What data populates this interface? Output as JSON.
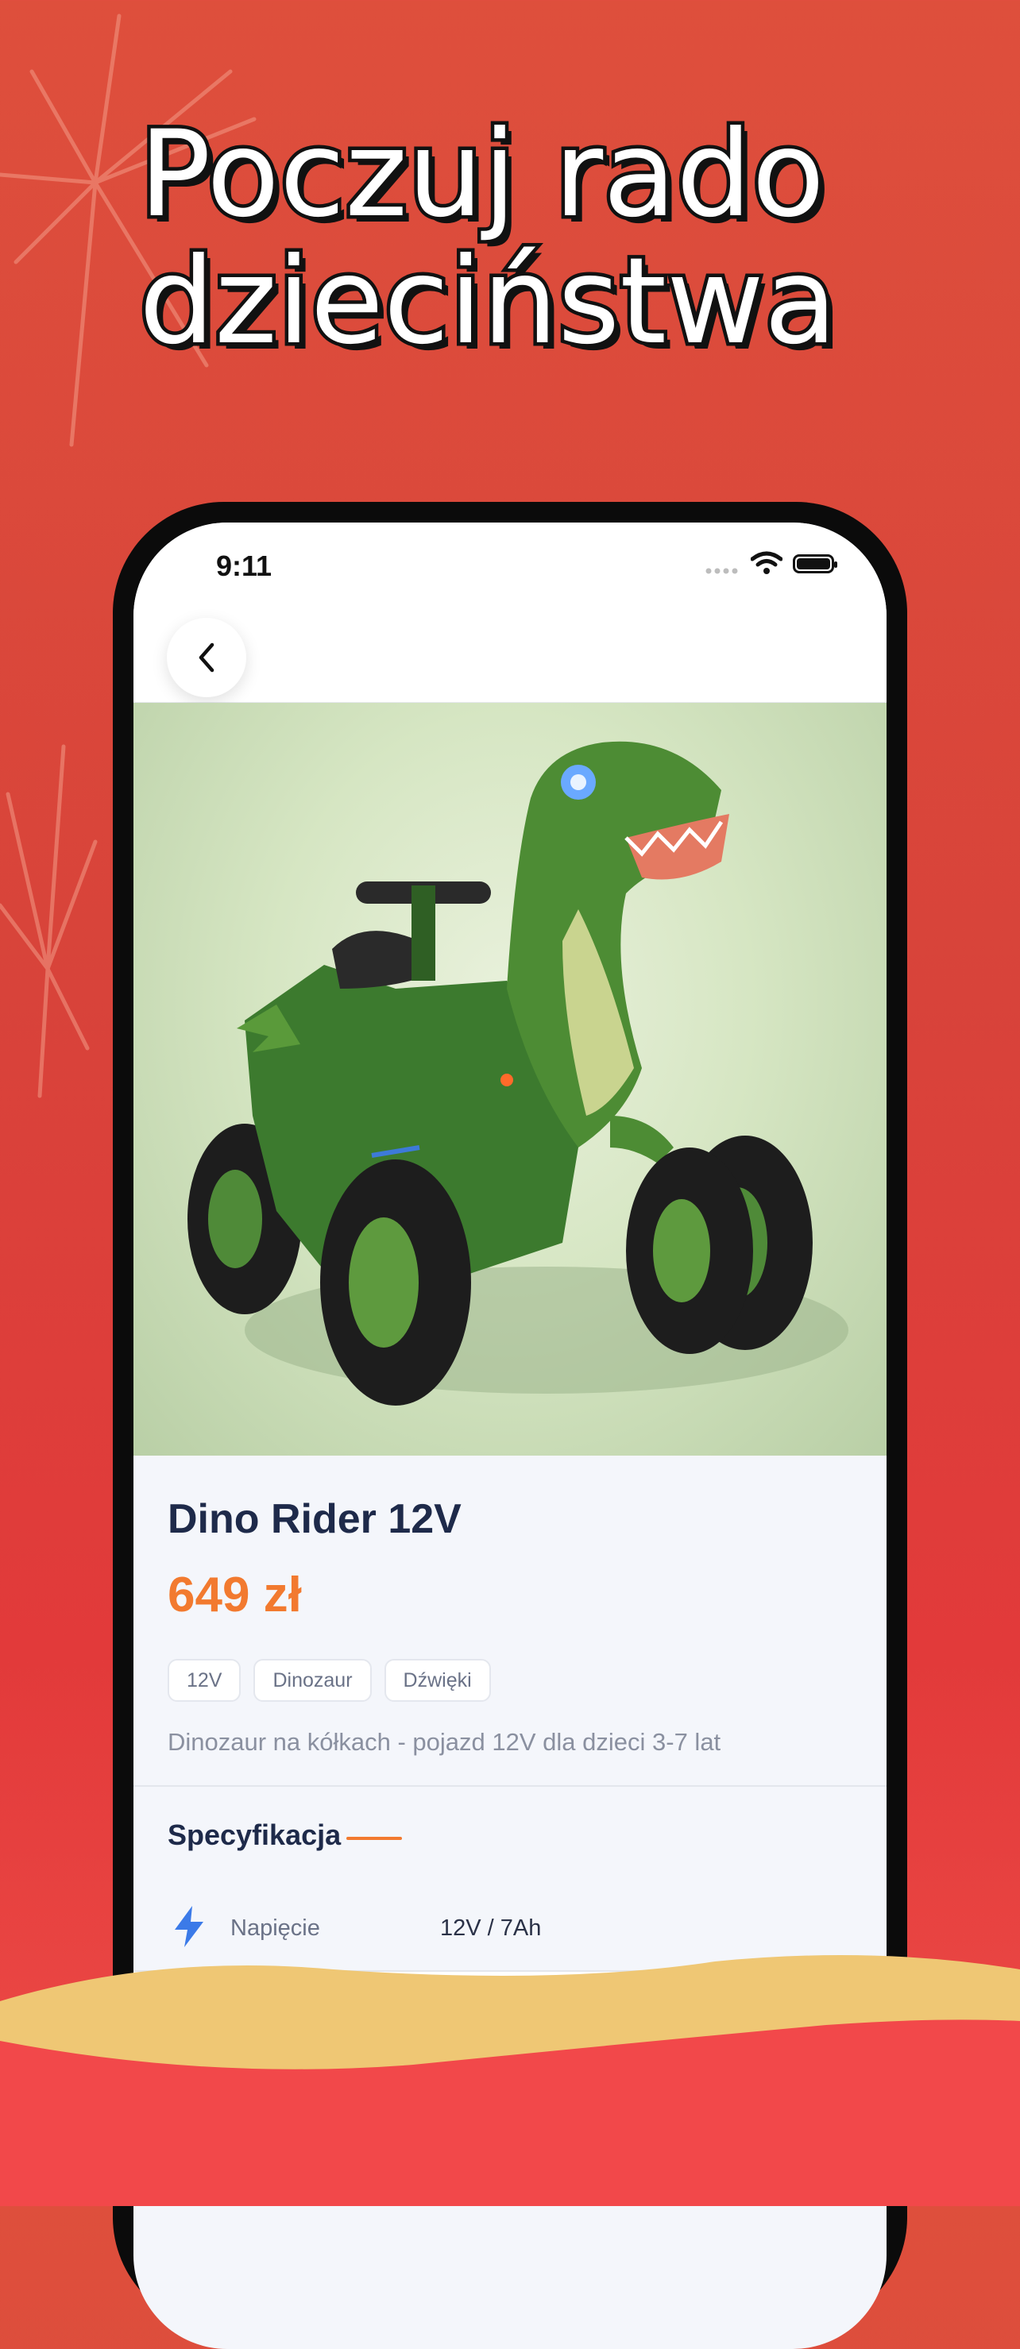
{
  "headline": {
    "line1": "Poczuj rado",
    "line2": "dzieciństwa"
  },
  "status_bar": {
    "time": "9:11"
  },
  "product": {
    "title": "Dino Rider 12V",
    "price": "649 zł",
    "tags": [
      "12V",
      "Dinozaur",
      "Dźwięki"
    ],
    "description": "Dinozaur na kółkach - pojazd 12V dla dzieci 3-7 lat",
    "image_alt": "Green dinosaur ride-on quad toy"
  },
  "specification": {
    "title": "Specyfikacja",
    "rows": [
      {
        "label": "Napięcie",
        "value": "12V / 7Ah",
        "icon": "bolt-icon"
      }
    ]
  },
  "colors": {
    "accent": "#f27a2f",
    "title": "#1e2a4a",
    "icon_blue": "#3b7ae8",
    "background_red": "#de4f3c",
    "wave_gold": "#efc774"
  }
}
